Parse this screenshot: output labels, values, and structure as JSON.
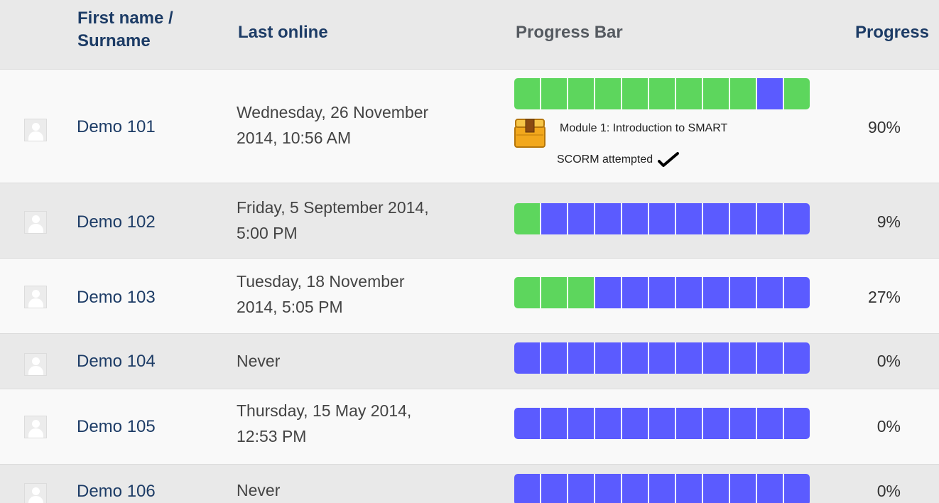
{
  "columns": {
    "name_line1": "First name /",
    "name_line2": "Surname",
    "last_online": "Last online",
    "progress_bar": "Progress Bar",
    "progress": "Progress"
  },
  "colors": {
    "completed": "#5dd65d",
    "not_completed": "#5b5bff"
  },
  "rows": [
    {
      "name": "Demo 101",
      "last_online_1": "Wednesday, 26 November",
      "last_online_2": "2014, 10:56 AM",
      "completed_cells": [
        1,
        1,
        1,
        1,
        1,
        1,
        1,
        1,
        1,
        0,
        1
      ],
      "progress": "90%",
      "detail": {
        "icon": "scorm-package-icon",
        "activity": "Module 1: Introduction to SMART",
        "status": "SCORM attempted",
        "status_icon": "checkmark-icon"
      }
    },
    {
      "name": "Demo 102",
      "last_online_1": "Friday, 5 September 2014,",
      "last_online_2": "5:00 PM",
      "completed_cells": [
        1,
        0,
        0,
        0,
        0,
        0,
        0,
        0,
        0,
        0,
        0
      ],
      "progress": "9%"
    },
    {
      "name": "Demo 103",
      "last_online_1": "Tuesday, 18 November",
      "last_online_2": "2014, 5:05 PM",
      "completed_cells": [
        1,
        1,
        1,
        0,
        0,
        0,
        0,
        0,
        0,
        0,
        0
      ],
      "progress": "27%"
    },
    {
      "name": "Demo 104",
      "last_online_1": "Never",
      "last_online_2": "",
      "completed_cells": [
        0,
        0,
        0,
        0,
        0,
        0,
        0,
        0,
        0,
        0,
        0
      ],
      "progress": "0%"
    },
    {
      "name": "Demo 105",
      "last_online_1": "Thursday, 15 May 2014,",
      "last_online_2": "12:53 PM",
      "completed_cells": [
        0,
        0,
        0,
        0,
        0,
        0,
        0,
        0,
        0,
        0,
        0
      ],
      "progress": "0%"
    },
    {
      "name": "Demo 106",
      "last_online_1": "Never",
      "last_online_2": "",
      "completed_cells": [
        0,
        0,
        0,
        0,
        0,
        0,
        0,
        0,
        0,
        0,
        0
      ],
      "progress": "0%"
    }
  ]
}
